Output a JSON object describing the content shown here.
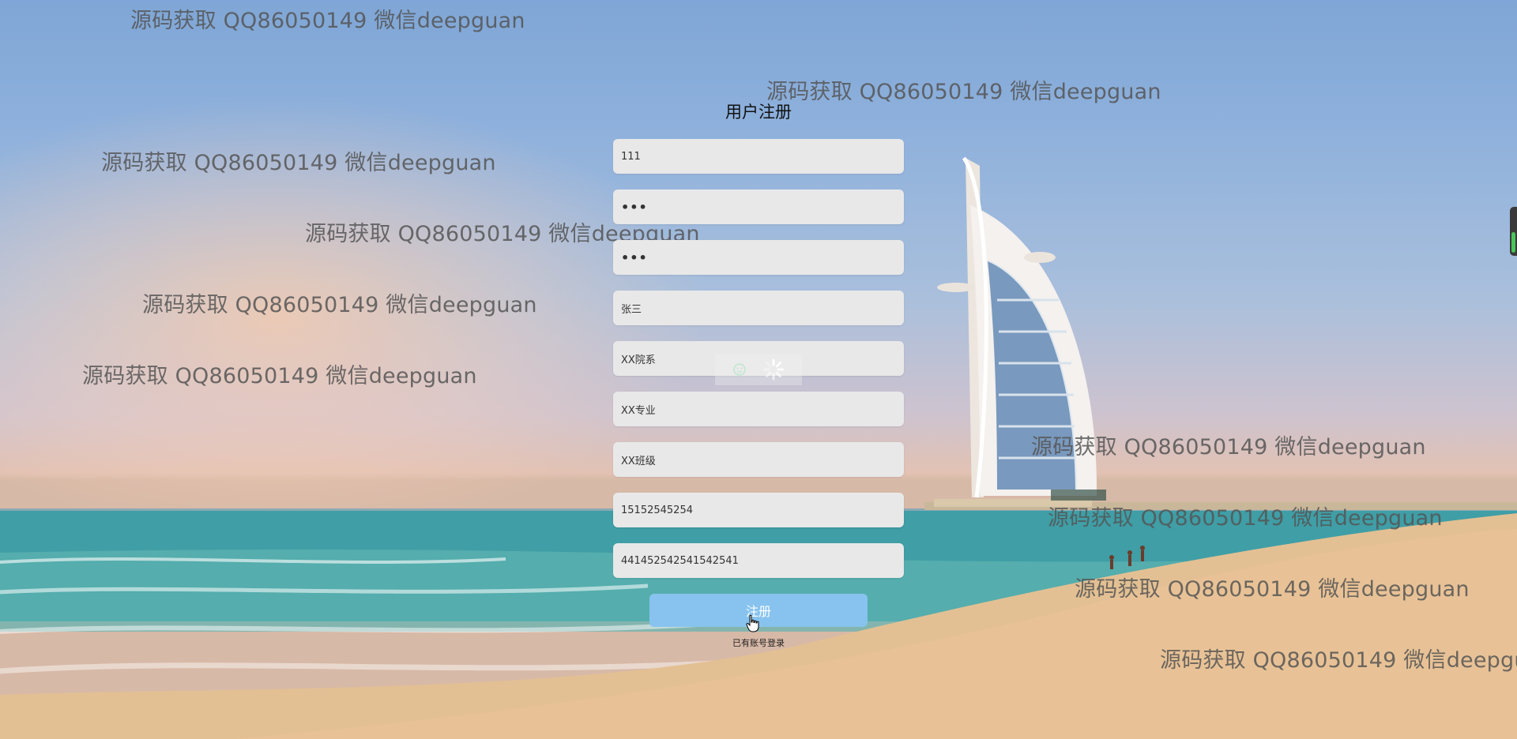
{
  "watermark_text": "源码获取 QQ86050149 微信deepguan",
  "form": {
    "title": "用户注册",
    "fields": {
      "username": "111",
      "password": "•••",
      "confirm_password": "•••",
      "name": "张三",
      "department": "XX院系",
      "major": "XX专业",
      "class_name": "XX班级",
      "phone": "15152545254",
      "id_number": "441452542541542541"
    },
    "submit_label": "注册",
    "login_link": "已有账号登录"
  },
  "colors": {
    "submit_bg": "#87c3ee",
    "field_bg": "#e8e8e8",
    "watermark": "#555555"
  },
  "icons": {
    "loader": "loading-spinner-icon",
    "cursor": "hand-pointer-icon"
  }
}
